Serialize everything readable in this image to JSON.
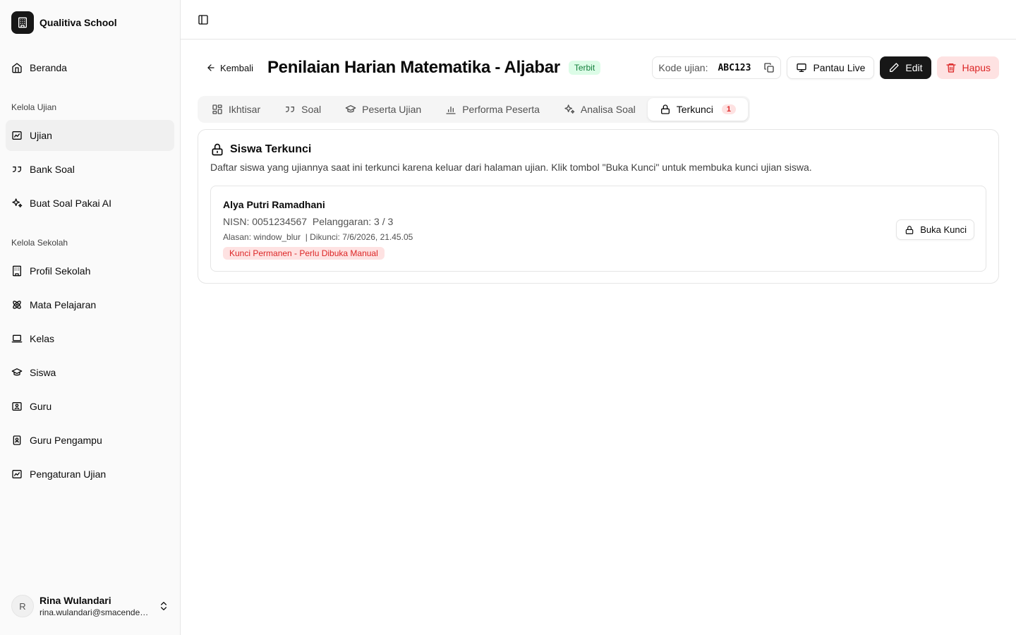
{
  "brand": {
    "name": "Qualitiva School"
  },
  "sidebar": {
    "home": "Beranda",
    "group_exam": "Kelola Ujian",
    "exam_items": [
      "Ujian",
      "Bank Soal",
      "Buat Soal Pakai AI"
    ],
    "group_school": "Kelola Sekolah",
    "school_items": [
      "Profil Sekolah",
      "Mata Pelajaran",
      "Kelas",
      "Siswa",
      "Guru",
      "Guru Pengampu",
      "Pengaturan Ujian"
    ]
  },
  "user": {
    "initial": "R",
    "name": "Rina Wulandari",
    "email": "rina.wulandari@smacendekia.sch.id"
  },
  "header": {
    "back_label": "Kembali",
    "title": "Penilaian Harian Matematika - Aljabar",
    "status": "Terbit",
    "code_label": "Kode ujian:",
    "code_value": "ABC123",
    "live_label": "Pantau Live",
    "edit_label": "Edit",
    "delete_label": "Hapus"
  },
  "tabs": [
    {
      "label": "Ikhtisar"
    },
    {
      "label": "Soal"
    },
    {
      "label": "Peserta Ujian"
    },
    {
      "label": "Performa Peserta"
    },
    {
      "label": "Analisa Soal"
    },
    {
      "label": "Terkunci",
      "count": "1"
    }
  ],
  "locked": {
    "title": "Siswa Terkunci",
    "description": "Daftar siswa yang ujiannya saat ini terkunci karena keluar dari halaman ujian. Klik tombol \"Buka Kunci\" untuk membuka kunci ujian siswa.",
    "students": [
      {
        "name": "Alya Putri Ramadhani",
        "meta": "NISN: 0051234567  Pelanggaran: 3 / 3",
        "reason": "Alasan: window_blur  | Dikunci: 7/6/2026, 21.45.05",
        "badge": "Kunci Permanen - Perlu Dibuka Manual",
        "unlock_label": "Buka Kunci"
      }
    ]
  },
  "colors": {
    "accent_dark": "#171717",
    "danger": "#dc2626",
    "success": "#15803d"
  }
}
